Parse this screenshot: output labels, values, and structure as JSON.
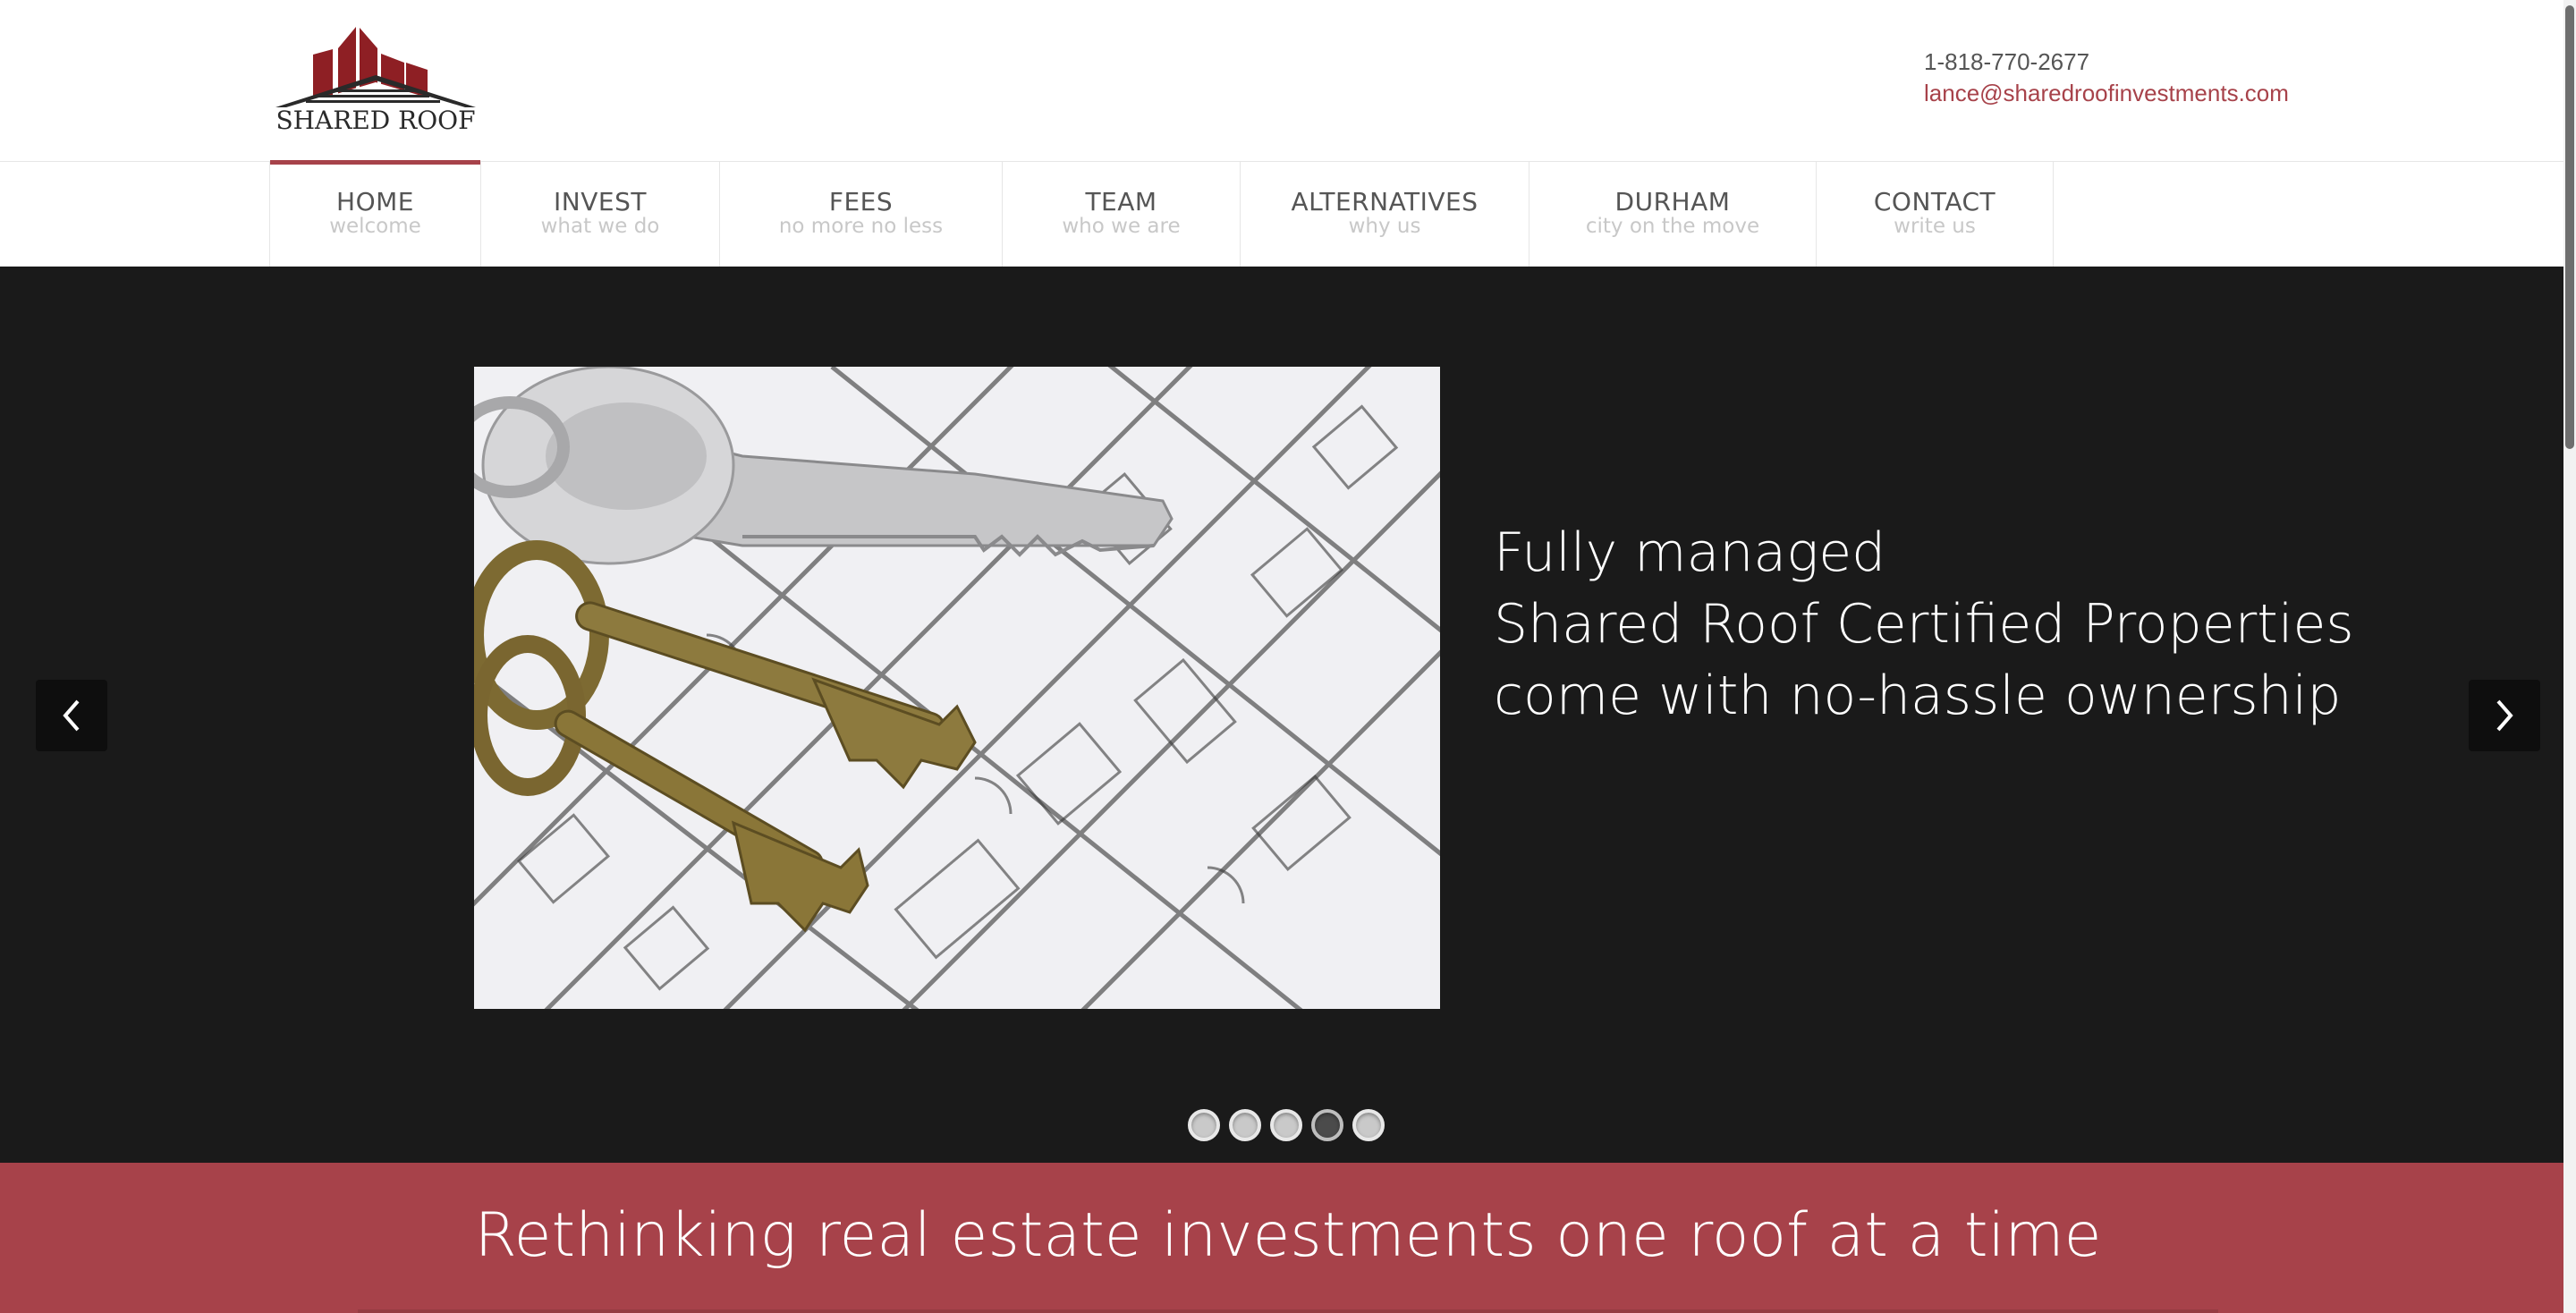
{
  "brand": {
    "logo_text": "SHARED ROOF",
    "accent_color": "#a7424a"
  },
  "contact": {
    "phone": "1-818-770-2677",
    "email": "lance@sharedroofinvestments.com"
  },
  "nav": {
    "items": [
      {
        "label": "HOME",
        "sub": "welcome",
        "active": true
      },
      {
        "label": "INVEST",
        "sub": "what we do"
      },
      {
        "label": "FEES",
        "sub": "no more no less"
      },
      {
        "label": "TEAM",
        "sub": "who we are"
      },
      {
        "label": "ALTERNATIVES",
        "sub": "why us"
      },
      {
        "label": "DURHAM",
        "sub": "city on the move"
      },
      {
        "label": "CONTACT",
        "sub": "write us"
      }
    ]
  },
  "slider": {
    "caption": {
      "line1": "Fully managed",
      "line2": "Shared Roof Certified Properties",
      "line3": "come with no-hassle ownership"
    },
    "prev_icon": "chevron-left-icon",
    "next_icon": "chevron-right-icon",
    "dots_count": 5,
    "active_dot": 4
  },
  "banner": {
    "text": "Rethinking real estate investments one roof at a time"
  }
}
